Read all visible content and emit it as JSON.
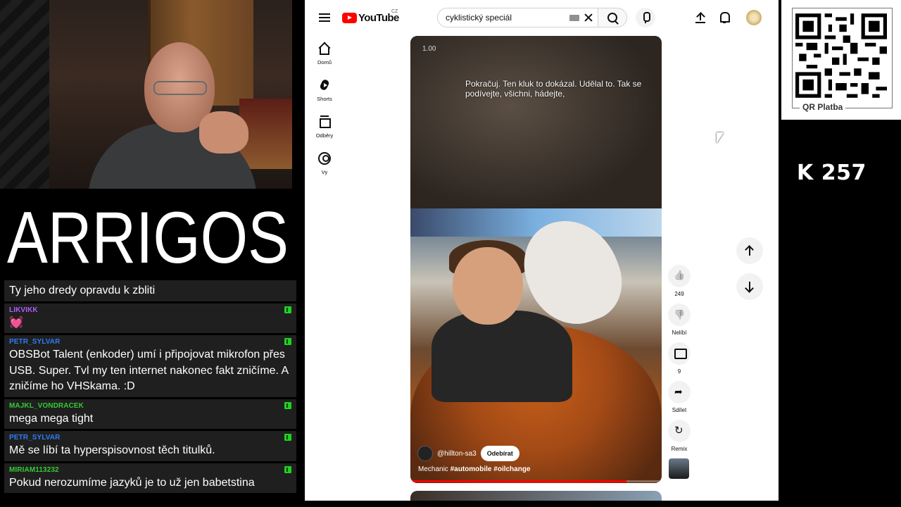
{
  "logo_text": "ARRIGOS",
  "chat": {
    "messages": [
      {
        "user": "",
        "user_color": "",
        "text": "Ty jeho dredy opravdu k zbliti",
        "badge": false
      },
      {
        "user": "LIKVIKK",
        "user_color": "#b05cff",
        "text": "💓",
        "badge": true
      },
      {
        "user": "PETR_SYLVAR",
        "user_color": "#2e7cf6",
        "text": "OBSBot Talent (enkoder) umí i připojovat mikrofon přes USB. Super. Tvl my ten internet nakonec fakt zničíme. A zničíme ho VHSkama. :D",
        "badge": true
      },
      {
        "user": "MAJKL_VONDRACEK",
        "user_color": "#33cc33",
        "text": "mega mega tight",
        "badge": true
      },
      {
        "user": "PETR_SYLVAR",
        "user_color": "#2e7cf6",
        "text": "Mě se líbí ta hyperspisovnost těch titulků.",
        "badge": true
      },
      {
        "user": "MIRIAM113232",
        "user_color": "#33cc33",
        "text": "Pokud nerozumíme jazyků je to už jen babetstina",
        "badge": true
      }
    ]
  },
  "youtube": {
    "logo": "YouTube",
    "country": "CZ",
    "search_value": "cyklistický speciál",
    "sidebar": [
      {
        "label": "Domů",
        "icon": "home-icon"
      },
      {
        "label": "Shorts",
        "icon": "shorts-icon"
      },
      {
        "label": "Odběry",
        "icon": "subscriptions-icon"
      },
      {
        "label": "Vy",
        "icon": "you-icon"
      }
    ],
    "short": {
      "speed": "1.00",
      "caption": "Pokračuj.  Ten kluk to dokázal.  Udělal to. Tak se podívejte, všichni, hádejte,",
      "channel": "@hillton-sa3",
      "subscribe_label": "Odebírat",
      "title_plain": "Mechanic",
      "title_tags": "#automobile #oilchange",
      "progress": 0.86
    },
    "actions": [
      {
        "label": "249",
        "icon": "like-icon"
      },
      {
        "label": "Nelíbí",
        "icon": "dislike-icon"
      },
      {
        "label": "9",
        "icon": "comment-icon"
      },
      {
        "label": "Sdílet",
        "icon": "share-icon"
      },
      {
        "label": "Remix",
        "icon": "remix-icon"
      }
    ]
  },
  "qr": {
    "label": "QR Platba"
  },
  "counter": "K 257"
}
